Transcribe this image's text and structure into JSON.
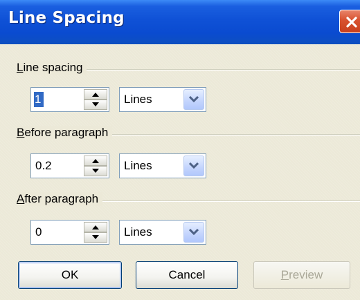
{
  "window": {
    "title": "Line Spacing"
  },
  "line_spacing": {
    "label_mnemonic": "L",
    "label_rest": "ine spacing",
    "value": "1",
    "unit": "Lines"
  },
  "before_paragraph": {
    "label_mnemonic": "B",
    "label_rest": "efore paragraph",
    "value": "0.2",
    "unit": "Lines"
  },
  "after_paragraph": {
    "label_mnemonic": "A",
    "label_rest": "fter paragraph",
    "value": "0",
    "unit": "Lines"
  },
  "buttons": {
    "ok": "OK",
    "cancel": "Cancel",
    "preview_mnemonic": "P",
    "preview_rest": "review"
  },
  "colors": {
    "titlebar": "#0a4bd0",
    "close_button": "#d8512f",
    "dialog_bg": "#ece9d8",
    "selection": "#316ac5"
  }
}
